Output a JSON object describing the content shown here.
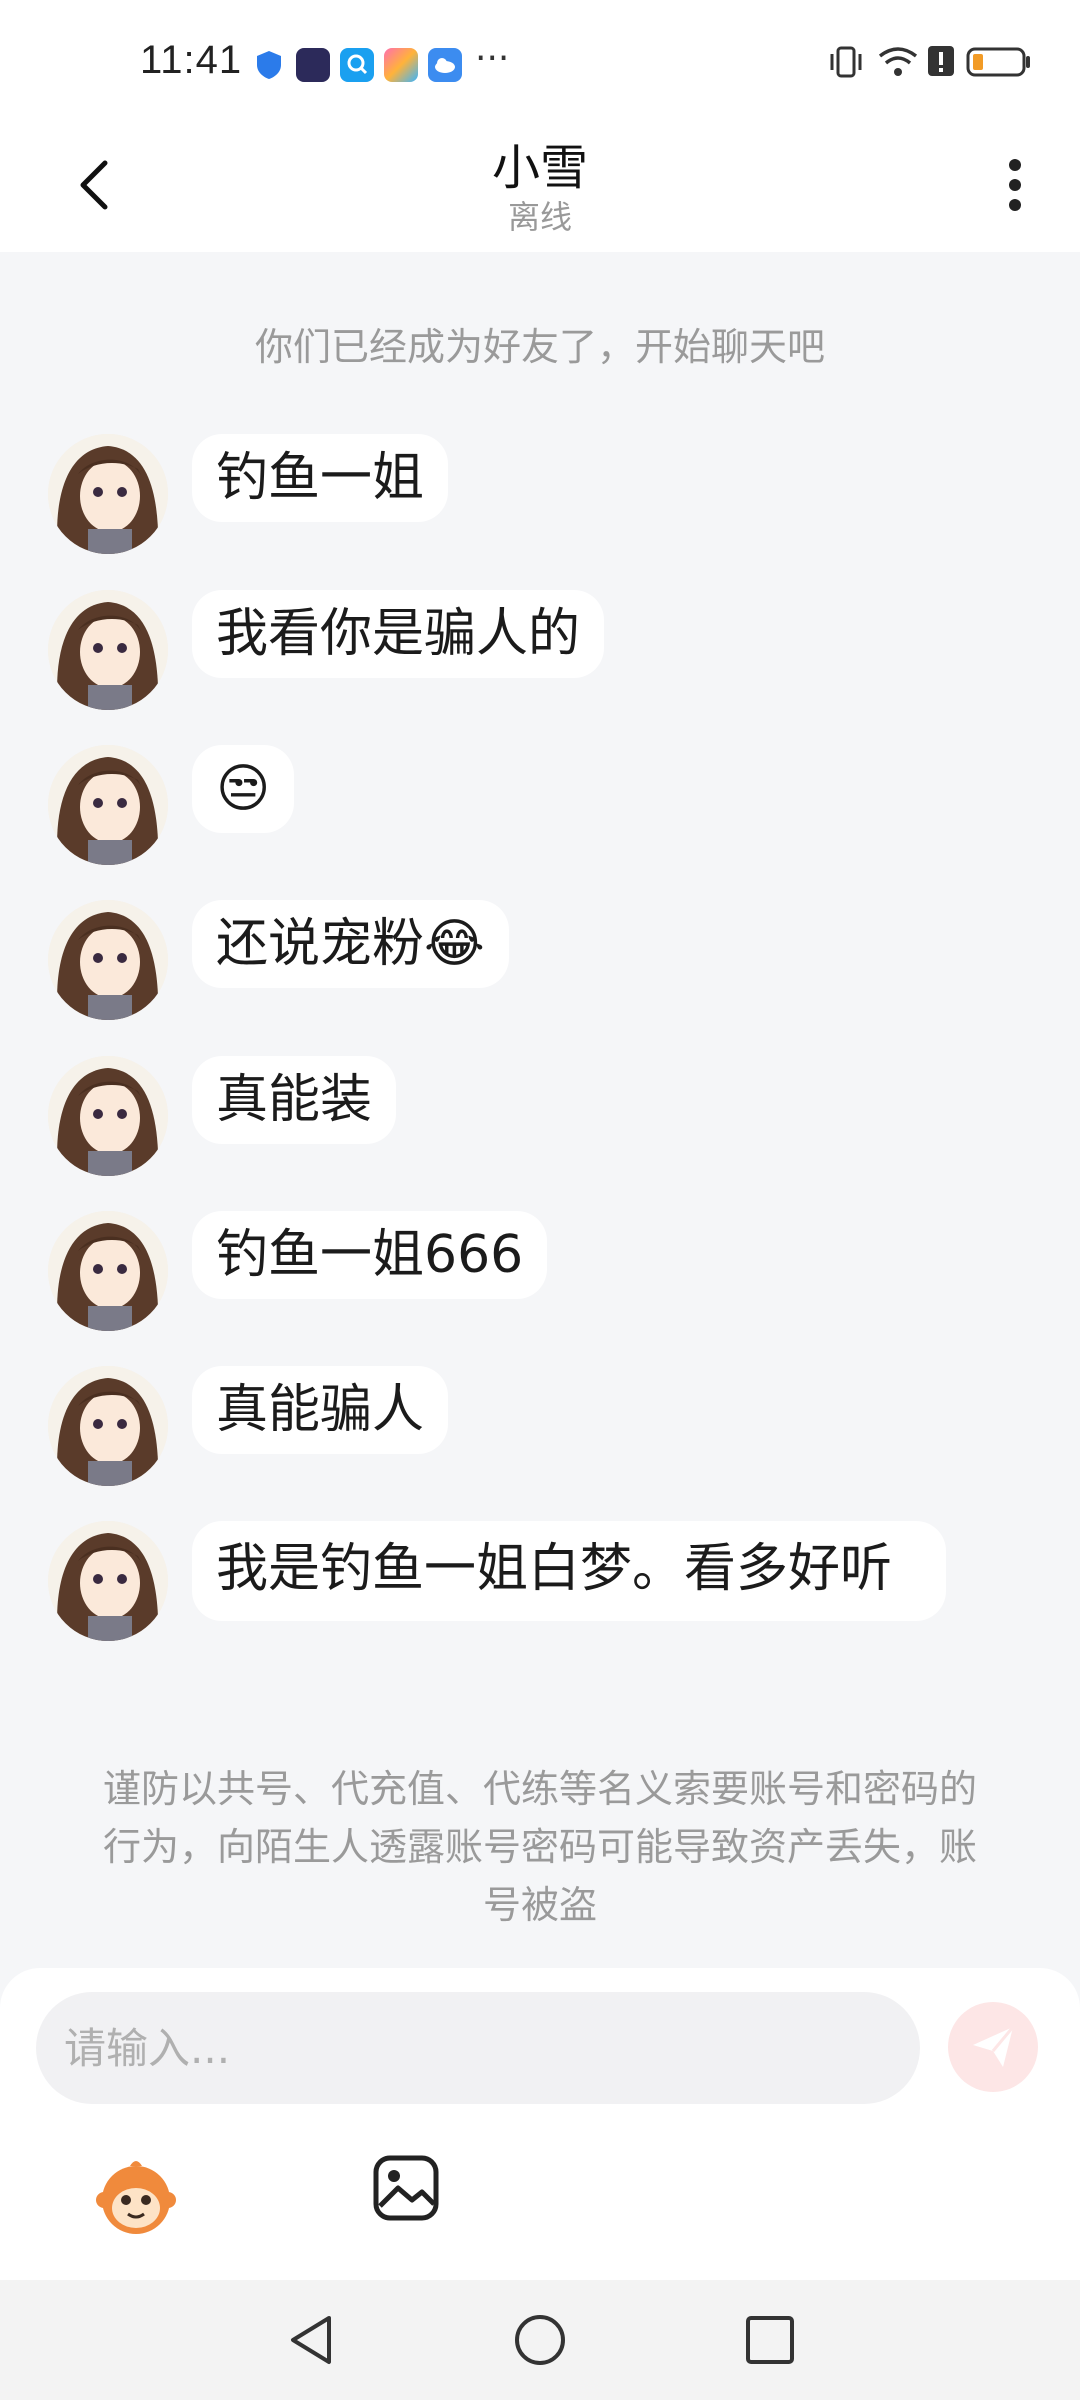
{
  "status_bar": {
    "time": "11:41",
    "more": "···",
    "icons": [
      "shield-icon",
      "app-icon",
      "search-app-icon",
      "tool-app-icon",
      "cloud-app-icon",
      "vibrate-icon",
      "wifi-icon",
      "alert-icon",
      "battery-icon"
    ]
  },
  "header": {
    "title": "小雪",
    "status": "离线"
  },
  "chat": {
    "system_notice": "你们已经成为好友了，开始聊天吧",
    "messages": [
      {
        "text": "钓鱼一姐"
      },
      {
        "text": "我看你是骗人的"
      },
      {
        "text": "😒"
      },
      {
        "text": "还说宠粉😂"
      },
      {
        "text": "真能装"
      },
      {
        "text": "钓鱼一姐666"
      },
      {
        "text": "真能骗人"
      },
      {
        "text": "我是钓鱼一姐白梦。看多好听"
      }
    ],
    "warning": "谨防以共号、代充值、代练等名义索要账号和密码的行为，向陌生人透露账号密码可能导致资产丢失，账号被盗"
  },
  "input": {
    "placeholder": "请输入..."
  },
  "colors": {
    "background": "#f5f6f8",
    "bubble": "#ffffff",
    "send_button": "#fde6e6",
    "send_icon": "#ffffff"
  }
}
